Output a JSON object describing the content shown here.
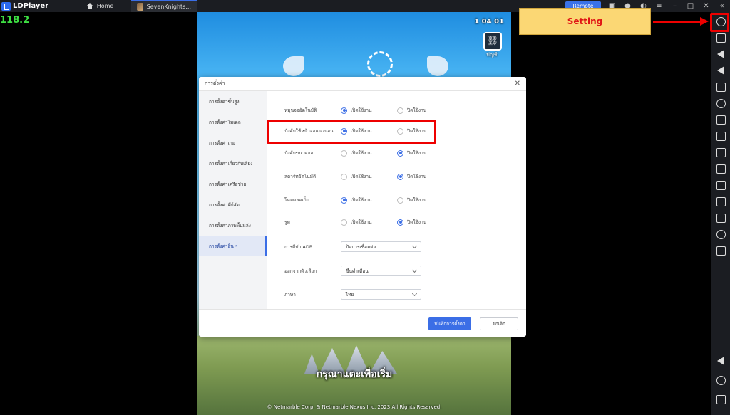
{
  "titlebar": {
    "app_name": "LDPlayer",
    "tabs": [
      {
        "label": "Home"
      },
      {
        "label": "SevenKnights..."
      }
    ],
    "remote_label": "Remote"
  },
  "fps": "118.2",
  "game": {
    "timer": "1 04 01",
    "link_label": "บัญชี",
    "tap_to_start": "กรุณาแตะเพื่อเริ่ม",
    "copyright": "© Netmarble Corp. & Netmarble Nexus Inc. 2023 All Rights Reserved."
  },
  "dialog": {
    "title": "การตั้งค่า",
    "sidebar": [
      {
        "label": "การตั้งค่าขั้นสูง"
      },
      {
        "label": "การตั้งค่าโมเดล"
      },
      {
        "label": "การตั้งค่าเกม"
      },
      {
        "label": "การตั้งค่าเกี่ยวกับเสียง"
      },
      {
        "label": "การตั้งค่าเครือข่าย"
      },
      {
        "label": "การตั้งค่าคีย์ลัด"
      },
      {
        "label": "การตั้งค่าภาพพื้นหลัง"
      },
      {
        "label": "การตั้งค่าอื่น ๆ"
      }
    ],
    "options": {
      "on": "เปิดใช้งาน",
      "off": "ปิดใช้งาน"
    },
    "toggle_rows": [
      {
        "label": "หมุนจออัตโนมัติ",
        "selected": "on"
      },
      {
        "label": "บังคับใช้หน้าจอแนวนอน",
        "selected": "on"
      },
      {
        "label": "บังคับขนาดจอ",
        "selected": "off"
      },
      {
        "label": "สตาร์ทอัตโนมัติ",
        "selected": "off"
      },
      {
        "label": "โหมดลดเก็บ",
        "selected": "on"
      },
      {
        "label": "รูท",
        "selected": "off"
      }
    ],
    "select_rows": [
      {
        "label": "การดีบัก ADB",
        "value": "ปิดการเชื่อมต่อ"
      },
      {
        "label": "ออกจากตัวเลือก",
        "value": "ขึ้นคำเตือน"
      },
      {
        "label": "ภาษา",
        "value": "ไทย"
      }
    ],
    "save_label": "บันทึกการตั้งค่า",
    "cancel_label": "ยกเลิก"
  },
  "callout": {
    "label": "Setting"
  }
}
